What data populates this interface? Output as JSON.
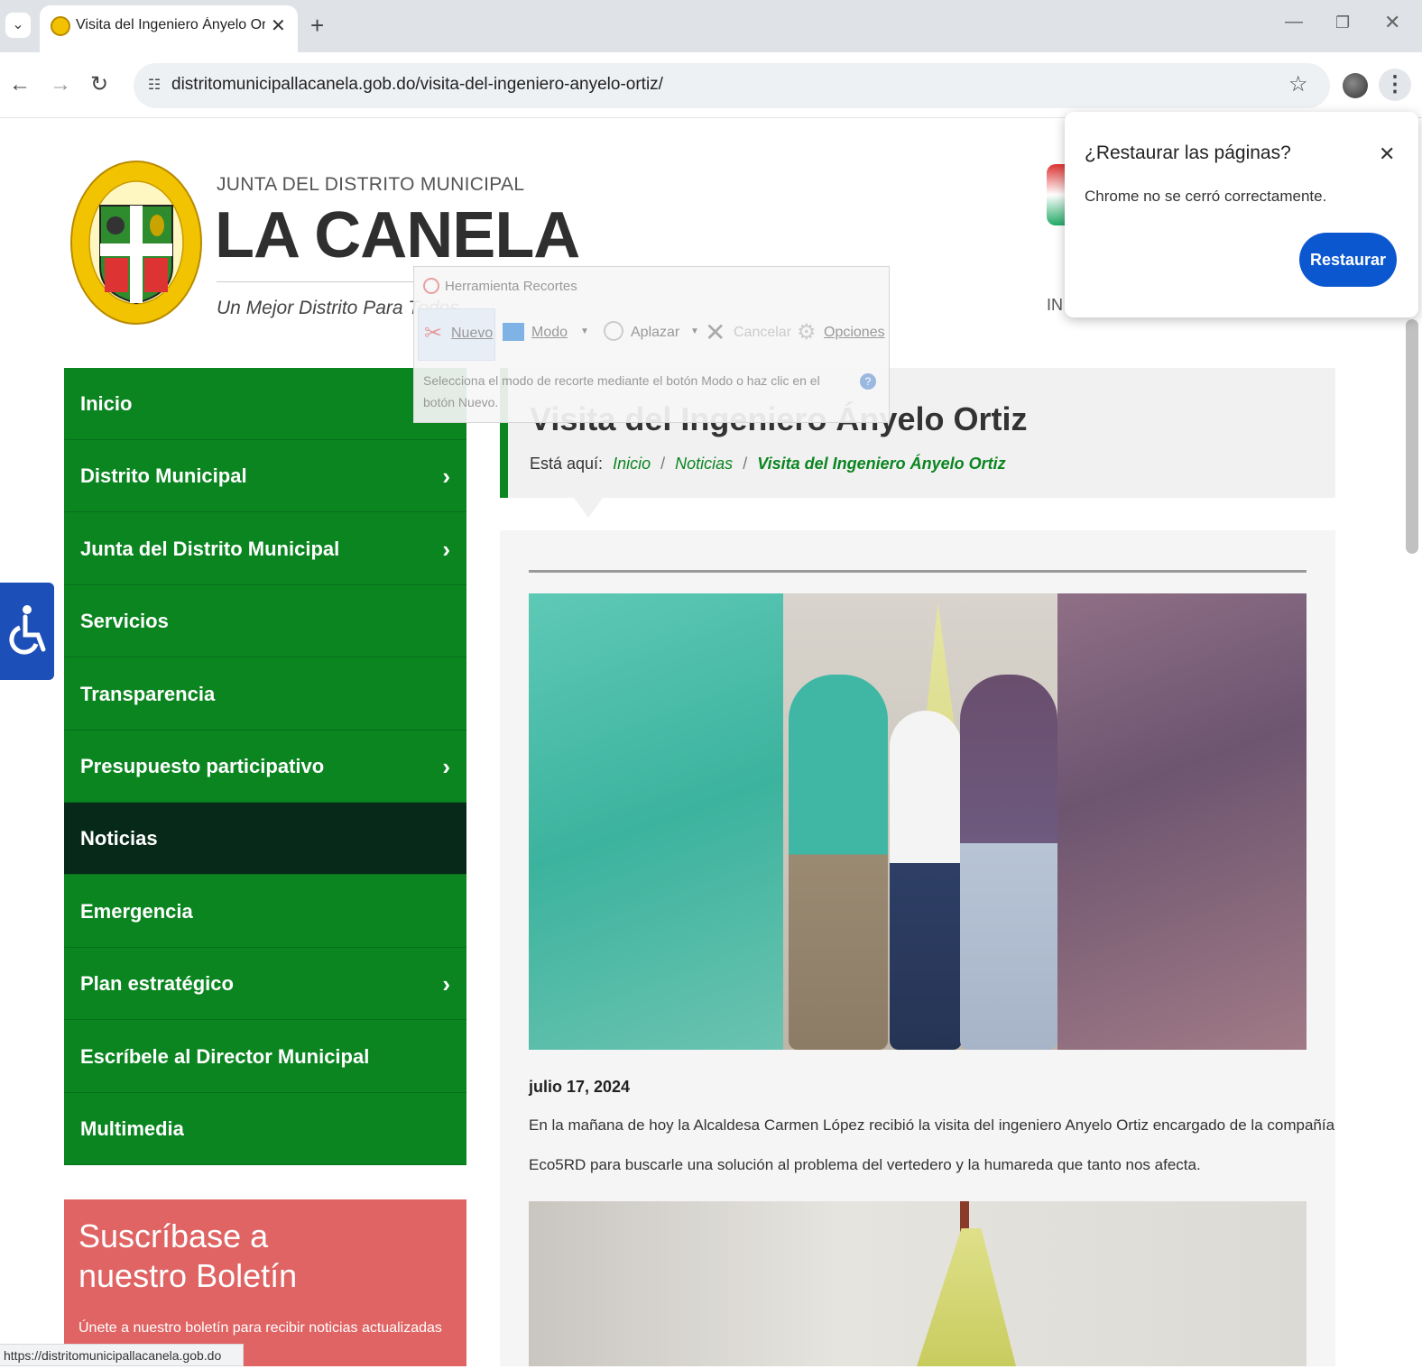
{
  "browser": {
    "tab_title": "Visita del Ingeniero Ányelo Orti",
    "url": "distritomunicipallacanela.gob.do/visita-del-ingeniero-anyelo-ortiz/",
    "status_url": "https://distritomunicipallacanela.gob.do"
  },
  "header": {
    "eyebrow": "JUNTA DEL DISTRITO MUNICIPAL",
    "site_name": "LA CANELA",
    "tagline": "Un Mejor Distrito Para Todos",
    "right_partial": "IN"
  },
  "snipping_tool": {
    "title": "Herramienta Recortes",
    "new": "Nuevo",
    "mode": "Modo",
    "delay": "Aplazar",
    "cancel": "Cancelar",
    "options": "Opciones",
    "hint": "Selecciona el modo de recorte mediante el botón Modo o haz clic en el botón Nuevo."
  },
  "restore_popup": {
    "title": "¿Restaurar las páginas?",
    "message": "Chrome no se cerró correctamente.",
    "button": "Restaurar"
  },
  "nav": {
    "items": [
      {
        "label": "Inicio",
        "has_sub": false,
        "active": false
      },
      {
        "label": "Distrito Municipal",
        "has_sub": true,
        "active": false
      },
      {
        "label": "Junta del Distrito Municipal",
        "has_sub": true,
        "active": false
      },
      {
        "label": "Servicios",
        "has_sub": false,
        "active": false
      },
      {
        "label": "Transparencia",
        "has_sub": false,
        "active": false
      },
      {
        "label": "Presupuesto participativo",
        "has_sub": true,
        "active": false
      },
      {
        "label": "Noticias",
        "has_sub": false,
        "active": true
      },
      {
        "label": "Emergencia",
        "has_sub": false,
        "active": false
      },
      {
        "label": "Plan estratégico",
        "has_sub": true,
        "active": false
      },
      {
        "label": "Escríbele al Director Municipal",
        "has_sub": false,
        "active": false
      },
      {
        "label": "Multimedia",
        "has_sub": false,
        "active": false
      }
    ]
  },
  "article": {
    "title": "Visita del Ingeniero Ányelo Ortiz",
    "breadcrumb_prefix": "Está aquí:",
    "breadcrumb": [
      "Inicio",
      "Noticias",
      "Visita del Ingeniero Ányelo Ortiz"
    ],
    "date": "julio 17, 2024",
    "body_line1": "En la mañana de hoy la Alcaldesa Carmen López recibió la visita del ingeniero Anyelo Ortiz encargado de la compañía",
    "body_line2": "Eco5RD para buscarle una solución al problema del vertedero y la humareda que tanto nos afecta."
  },
  "newsletter": {
    "title_line1": "Suscríbase a",
    "title_line2": "nuestro Boletín",
    "text": "Únete a nuestro boletín para recibir noticias actualizadas sobre nuestro municipio."
  },
  "colors": {
    "nav_green": "#0a8520",
    "nav_active": "#06291a",
    "newsletter_red": "#e06464",
    "restore_blue": "#0b57d0",
    "access_blue": "#1d4fb8"
  },
  "icons": [
    "tab-search-icon",
    "favicon-icon",
    "close-tab-icon",
    "new-tab-icon",
    "minimize-icon",
    "restore-window-icon",
    "close-window-icon",
    "back-icon",
    "forward-icon",
    "reload-icon",
    "site-info-icon",
    "star-icon",
    "profile-avatar",
    "menu-icon",
    "accessibility-icon",
    "chevron-right-icon"
  ]
}
